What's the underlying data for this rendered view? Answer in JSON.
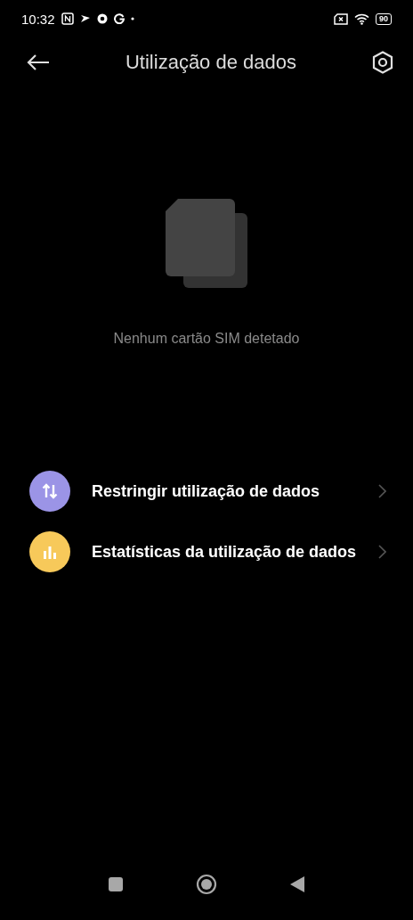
{
  "status_bar": {
    "time": "10:32",
    "battery": "90"
  },
  "header": {
    "title": "Utilização de dados"
  },
  "empty_state": {
    "message": "Nenhum cartão SIM detetado"
  },
  "items": [
    {
      "kind": "arrows",
      "label": "Restringir utilização de dados",
      "color": "#9b94e6"
    },
    {
      "kind": "chart",
      "label": "Estatísticas da utilização de dados",
      "color": "#f7c95a"
    }
  ]
}
